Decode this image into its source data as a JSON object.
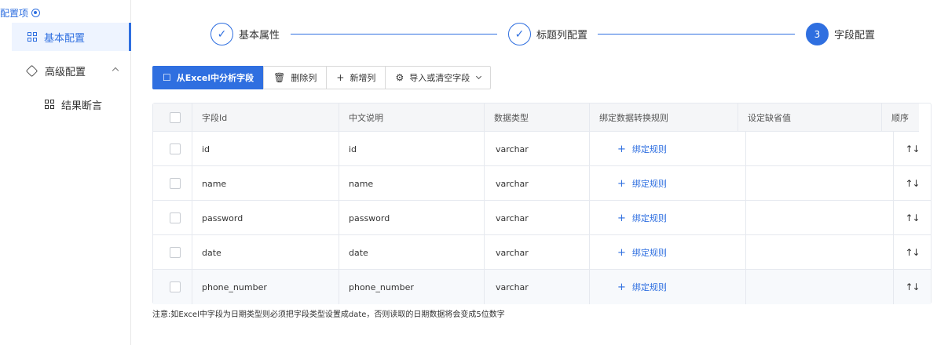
{
  "sidebar": {
    "title": "配置项",
    "items": [
      {
        "label": "基本配置"
      },
      {
        "label": "高级配置"
      },
      {
        "label": "结果断言"
      }
    ]
  },
  "steps": [
    {
      "label": "基本属性",
      "status": "done"
    },
    {
      "label": "标题列配置",
      "status": "done"
    },
    {
      "number": "3",
      "label": "字段配置",
      "status": "current"
    }
  ],
  "toolbar": {
    "analyze": "从Excel中分析字段",
    "delete_col": "删除列",
    "add_col": "新增列",
    "import_clear": "导入或清空字段"
  },
  "table": {
    "headers": [
      "字段Id",
      "中文说明",
      "数据类型",
      "绑定数据转换规则",
      "设定缺省值",
      "顺序"
    ],
    "bind_label": "绑定规则",
    "order_glyph": "↑↓",
    "rows": [
      {
        "field_id": "id",
        "desc": "id",
        "type": "varchar"
      },
      {
        "field_id": "name",
        "desc": "name",
        "type": "varchar"
      },
      {
        "field_id": "password",
        "desc": "password",
        "type": "varchar"
      },
      {
        "field_id": "date",
        "desc": "date",
        "type": "varchar"
      },
      {
        "field_id": "phone_number",
        "desc": "phone_number",
        "type": "varchar"
      }
    ]
  },
  "note": "注意:如Excel中字段为日期类型则必须把字段类型设置成date，否则读取的日期数据将会变成5位数字",
  "colors": {
    "accent": "#2f6fe0",
    "border": "#e6e9ef",
    "header_bg": "#f5f6f8"
  }
}
